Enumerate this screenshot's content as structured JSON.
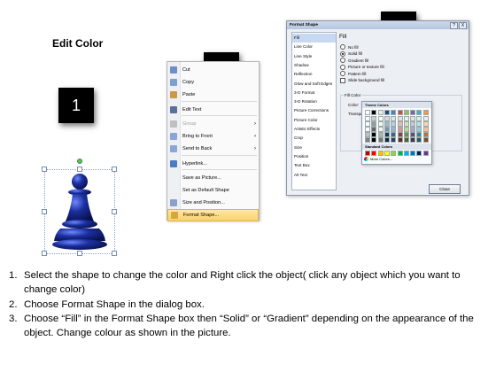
{
  "title": "Edit Color",
  "steps": [
    "1",
    "2",
    "3"
  ],
  "context_menu": {
    "items": [
      {
        "label": "Cut",
        "icon": "scissors-icon",
        "color": "#6d8fc4",
        "arrow": false,
        "disabled": false
      },
      {
        "label": "Copy",
        "icon": "copy-icon",
        "color": "#7ea0cf",
        "arrow": false,
        "disabled": false
      },
      {
        "label": "Paste",
        "icon": "paste-icon",
        "color": "#c99a4a",
        "arrow": false,
        "disabled": false
      },
      {
        "label": "Edit Text",
        "icon": "edit-text-icon",
        "color": "#5a6f9a",
        "arrow": false,
        "disabled": false
      },
      {
        "label": "Group",
        "icon": "group-icon",
        "color": "#c0c0c0",
        "arrow": true,
        "disabled": true
      },
      {
        "label": "Bring to Front",
        "icon": "bring-to-front-icon",
        "color": "#8aa6d8",
        "arrow": true,
        "disabled": false
      },
      {
        "label": "Send to Back",
        "icon": "send-to-back-icon",
        "color": "#8aa6d8",
        "arrow": true,
        "disabled": false
      },
      {
        "label": "Hyperlink...",
        "icon": "hyperlink-icon",
        "color": "#4c7cc4",
        "arrow": false,
        "disabled": false
      },
      {
        "label": "Save as Picture...",
        "icon": "",
        "color": "",
        "arrow": false,
        "disabled": false
      },
      {
        "label": "Set as Default Shape",
        "icon": "",
        "color": "",
        "arrow": false,
        "disabled": false
      },
      {
        "label": "Size and Position...",
        "icon": "size-position-icon",
        "color": "#8aa0c8",
        "arrow": false,
        "disabled": false
      },
      {
        "label": "Format Shape...",
        "icon": "format-shape-icon",
        "color": "#d9a441",
        "arrow": false,
        "disabled": false,
        "highlighted": true
      }
    ]
  },
  "dialog": {
    "title": "Format Shape",
    "help": "?",
    "close": "X",
    "nav": [
      "Fill",
      "Line Color",
      "Line Style",
      "Shadow",
      "Reflection",
      "Glow and Soft Edges",
      "3-D Format",
      "3-D Rotation",
      "Picture Corrections",
      "Picture Color",
      "Artistic Effects",
      "Crop",
      "Size",
      "Position",
      "Text Box",
      "Alt Text"
    ],
    "pane_title": "Fill",
    "options": [
      {
        "label": "No fill",
        "type": "radio",
        "on": false
      },
      {
        "label": "Solid fill",
        "type": "radio",
        "on": true
      },
      {
        "label": "Gradient fill",
        "type": "radio",
        "on": false
      },
      {
        "label": "Picture or texture fill",
        "type": "radio",
        "on": false
      },
      {
        "label": "Pattern fill",
        "type": "radio",
        "on": false
      },
      {
        "label": "Slide background fill",
        "type": "check",
        "on": false
      }
    ],
    "fill_color_group": "Fill Color",
    "color_label": "Color:",
    "transparency_label": "Transpare",
    "palette": {
      "theme_label": "Theme Colors",
      "standard_label": "Standard Colors",
      "more_label": "More Colors...",
      "theme_top": [
        "#ffffff",
        "#000000",
        "#eeece1",
        "#1f497d",
        "#4f81bd",
        "#c0504d",
        "#9bbb59",
        "#8064a2",
        "#4bacc6",
        "#f79646"
      ],
      "standard": [
        "#c00000",
        "#ff0000",
        "#ffc000",
        "#ffff00",
        "#92d050",
        "#00b050",
        "#00b0f0",
        "#0070c0",
        "#002060",
        "#7030a0"
      ]
    },
    "close_button": "Close"
  },
  "instructions": [
    {
      "num": "1.",
      "text": "Select the shape to change the color and Right click the object( click any object which you want to change color)"
    },
    {
      "num": "2.",
      "text": "Choose Format Shape in the dialog box."
    },
    {
      "num": "3.",
      "text": "Choose “Fill” in the Format Shape box then “Solid” or “Gradient” depending on the appearance of the object. Change colour as shown in the picture."
    }
  ],
  "colors": {
    "pawn": "#1a2f9c",
    "badge": "#000000",
    "menu_highlight": "#f8d26a",
    "nav_selected": "#c6d9f0"
  }
}
